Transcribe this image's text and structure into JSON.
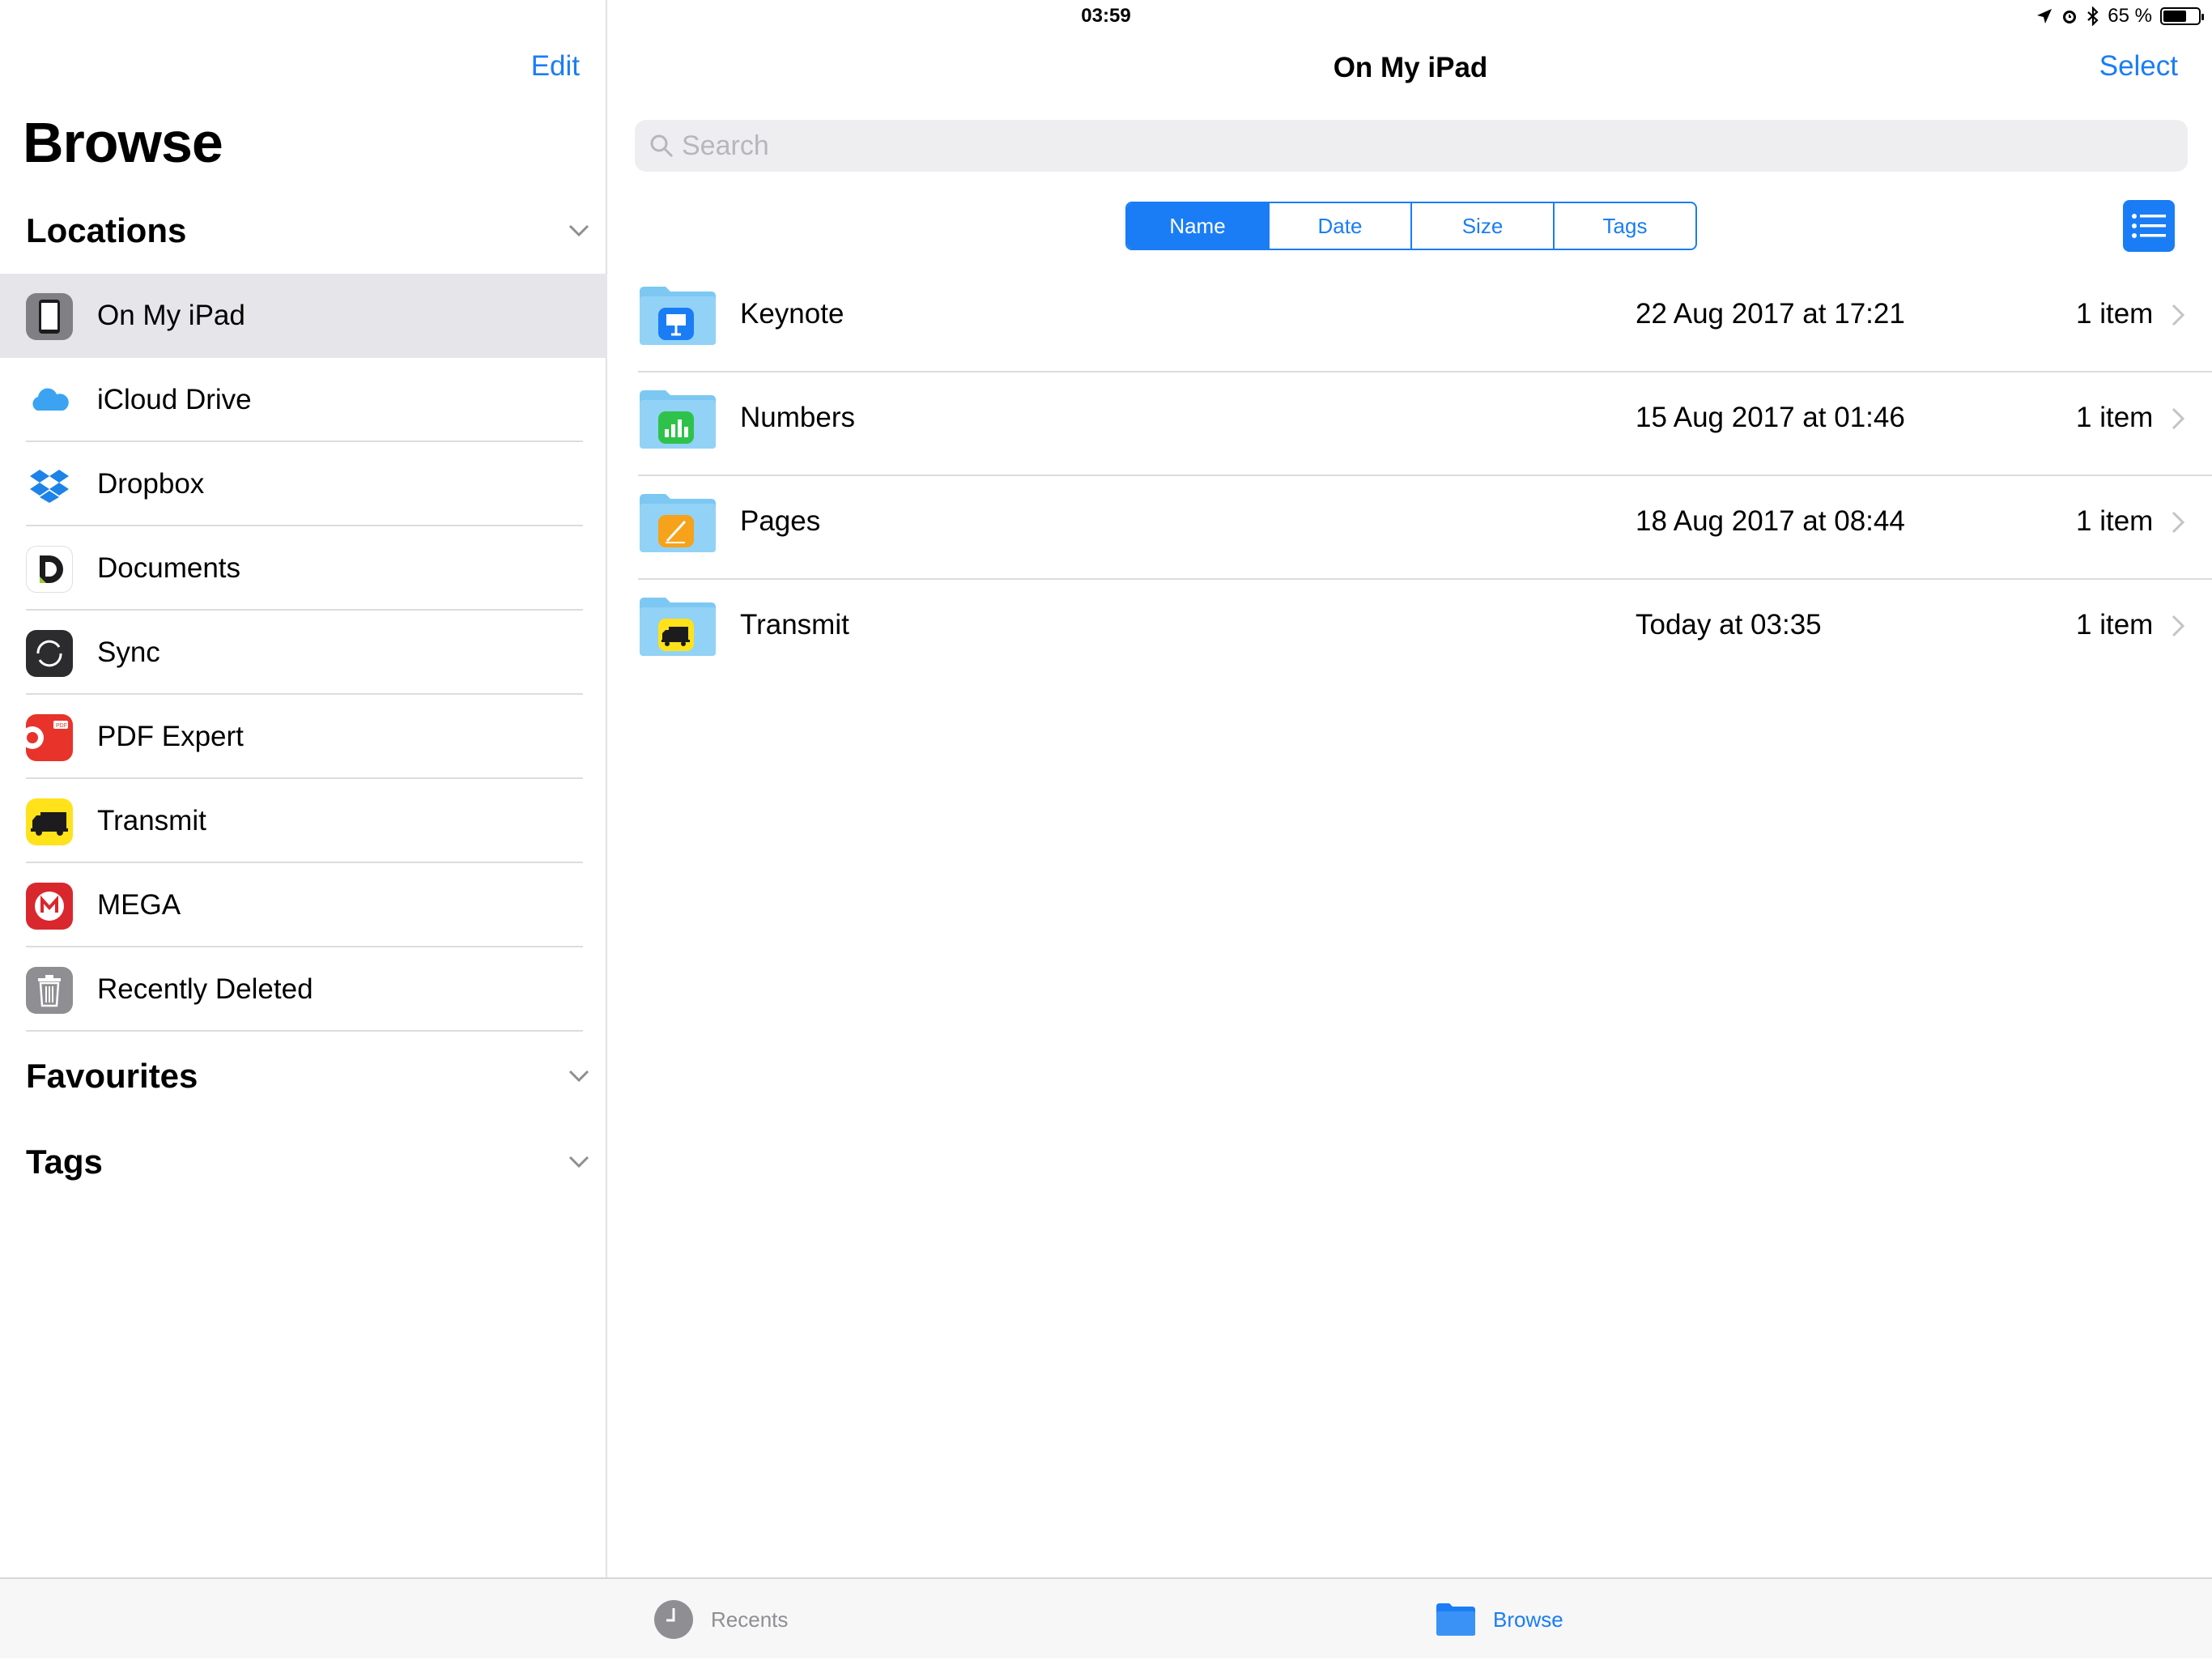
{
  "status_bar": {
    "device": "iPad",
    "time": "03:59",
    "battery": "65 %",
    "battery_level": 0.65
  },
  "sidebar": {
    "edit_label": "Edit",
    "title": "Browse",
    "sections": {
      "locations": "Locations",
      "favourites": "Favourites",
      "tags": "Tags"
    },
    "locations": [
      {
        "label": "On My iPad",
        "icon": "ipad-icon",
        "selected": true
      },
      {
        "label": "iCloud Drive",
        "icon": "icloud-icon"
      },
      {
        "label": "Dropbox",
        "icon": "dropbox-icon"
      },
      {
        "label": "Documents",
        "icon": "documents-icon"
      },
      {
        "label": "Sync",
        "icon": "sync-icon"
      },
      {
        "label": "PDF Expert",
        "icon": "pdf-expert-icon"
      },
      {
        "label": "Transmit",
        "icon": "transmit-icon"
      },
      {
        "label": "MEGA",
        "icon": "mega-icon"
      },
      {
        "label": "Recently Deleted",
        "icon": "trash-icon"
      }
    ]
  },
  "main": {
    "title": "On My iPad",
    "select_label": "Select",
    "search_placeholder": "Search",
    "sort_options": [
      "Name",
      "Date",
      "Size",
      "Tags"
    ],
    "active_sort": "Name",
    "files": [
      {
        "name": "Keynote",
        "date": "22 Aug 2017 at 17:21",
        "count": "1 item",
        "app_icon": "keynote-icon"
      },
      {
        "name": "Numbers",
        "date": "15 Aug 2017 at 01:46",
        "count": "1 item",
        "app_icon": "numbers-icon"
      },
      {
        "name": "Pages",
        "date": "18 Aug 2017 at 08:44",
        "count": "1 item",
        "app_icon": "pages-icon"
      },
      {
        "name": "Transmit",
        "date": "Today at 03:35",
        "count": "1 item",
        "app_icon": "transmit-icon"
      }
    ]
  },
  "tabbar": {
    "recents": "Recents",
    "browse": "Browse"
  },
  "colors": {
    "accent": "#1a7df5",
    "selected_row": "#e5e5ea",
    "folder": "#7cc8f3"
  }
}
